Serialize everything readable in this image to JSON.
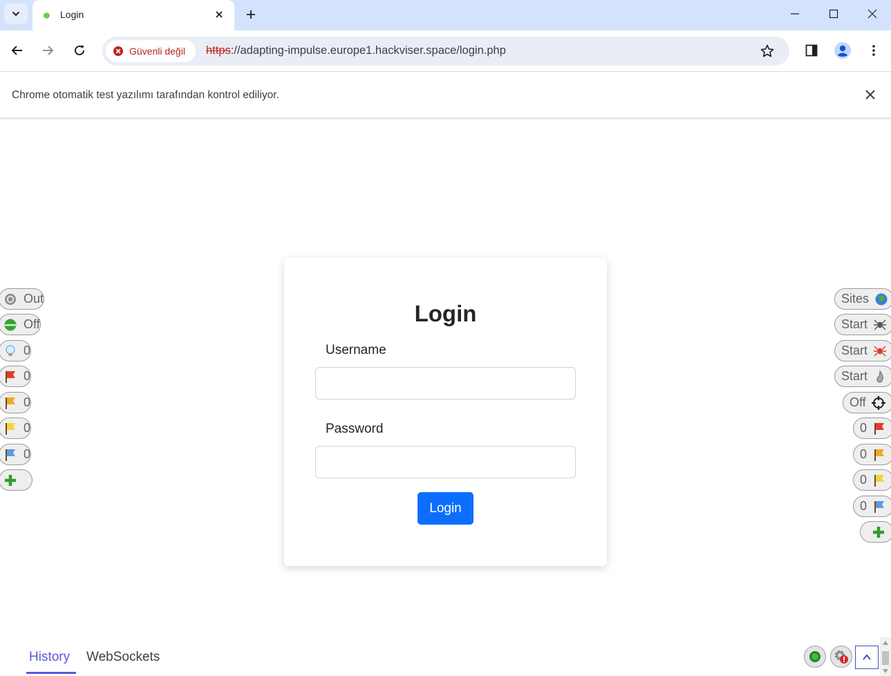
{
  "browser": {
    "tab_title": "Login",
    "url_scheme": "https",
    "url_rest": "://adapting-impulse.europe1.hackviser.space/login.php",
    "security_label": "Güvenli değil",
    "infobar_text": "Chrome otomatik test yazılımı tarafından kontrol ediliyor."
  },
  "login": {
    "title": "Login",
    "username_label": "Username",
    "password_label": "Password",
    "button_label": "Login"
  },
  "hud_left": [
    {
      "icon": "target-icon",
      "label": "Out"
    },
    {
      "icon": "green-dot-icon",
      "label": "Off"
    },
    {
      "icon": "lightbulb-icon",
      "label": "0"
    },
    {
      "icon": "red-flag-icon",
      "label": "0"
    },
    {
      "icon": "orange-flag-icon",
      "label": "0"
    },
    {
      "icon": "yellow-flag-icon",
      "label": "0"
    },
    {
      "icon": "blue-flag-icon",
      "label": "0"
    },
    {
      "icon": "add-icon",
      "label": ""
    }
  ],
  "hud_right": [
    {
      "icon": "globe-icon",
      "label": "Sites"
    },
    {
      "icon": "spider-icon",
      "label": "Start"
    },
    {
      "icon": "ajax-spider-icon",
      "label": "Start"
    },
    {
      "icon": "flame-icon",
      "label": "Start"
    },
    {
      "icon": "crosshair-icon",
      "label": "Off"
    },
    {
      "icon": "red-flag-icon",
      "label": "0"
    },
    {
      "icon": "orange-flag-icon",
      "label": "0"
    },
    {
      "icon": "yellow-flag-icon",
      "label": "0"
    },
    {
      "icon": "blue-flag-icon",
      "label": "0"
    },
    {
      "icon": "add-icon",
      "label": ""
    }
  ],
  "bottom": {
    "tabs": [
      "History",
      "WebSockets"
    ]
  },
  "colors": {
    "accent": "#0d6efd",
    "tabstrip": "#d3e3fd",
    "hud_tab_active": "#5b5bd6",
    "insecure_red": "#b3261e"
  }
}
